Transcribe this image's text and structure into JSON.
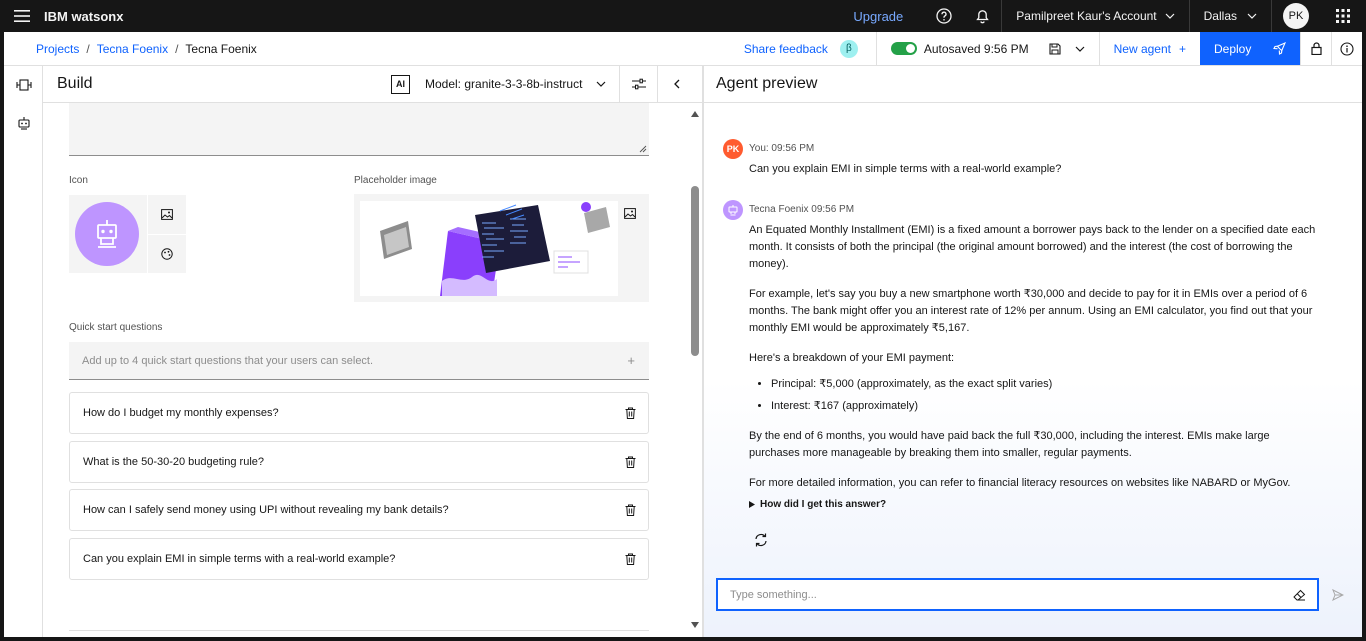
{
  "topbar": {
    "brand": "IBM watsonx",
    "upgrade": "Upgrade",
    "account": "Pamilpreet Kaur's Account",
    "region": "Dallas",
    "avatar_initials": "PK"
  },
  "breadcrumb": {
    "items": [
      "Projects",
      "Tecna Foenix",
      "Tecna Foenix"
    ],
    "separator": "/"
  },
  "actions": {
    "share_feedback": "Share feedback",
    "beta": "β",
    "autosaved": "Autosaved 9:56 PM",
    "new_agent": "New agent",
    "new_agent_icon": "+",
    "deploy": "Deploy"
  },
  "build": {
    "title": "Build",
    "ai_badge": "AI",
    "model": "Model: granite-3-3-8b-instruct",
    "icon_label": "Icon",
    "placeholder_label": "Placeholder image",
    "quick_start_label": "Quick start questions",
    "quick_start_placeholder": "Add up to 4 quick start questions that your users can select.",
    "add_symbol": "+",
    "questions": [
      "How do I budget my monthly expenses?",
      "What is the 50-30-20 budgeting rule?",
      "How can I safely send money using UPI without revealing my bank details?",
      "Can you explain EMI in simple terms with a real-world example?"
    ]
  },
  "preview": {
    "title": "Agent preview",
    "user_initials": "PK",
    "user_meta": "You: 09:56 PM",
    "user_message": "Can you explain EMI in simple terms with a real-world example?",
    "agent_meta": "Tecna Foenix 09:56 PM",
    "agent_p1": "An Equated Monthly Installment (EMI) is a fixed amount a borrower pays back to the lender on a specified date each month. It consists of both the principal (the original amount borrowed) and the interest (the cost of borrowing the money).",
    "agent_p2": "For example, let's say you buy a new smartphone worth ₹30,000 and decide to pay for it in EMIs over a period of 6 months. The bank might offer you an interest rate of 12% per annum. Using an EMI calculator, you find out that your monthly EMI would be approximately ₹5,167.",
    "agent_p3": "Here's a breakdown of your EMI payment:",
    "agent_bullets": [
      "Principal: ₹5,000 (approximately, as the exact split varies)",
      "Interest: ₹167 (approximately)"
    ],
    "agent_p4": "By the end of 6 months, you would have paid back the full ₹30,000, including the interest. EMIs make large purchases more manageable by breaking them into smaller, regular payments.",
    "agent_p5": "For more detailed information, you can refer to financial literacy resources on websites like NABARD or MyGov.",
    "how_did": "How did I get this answer?",
    "input_placeholder": "Type something..."
  },
  "colors": {
    "primary": "#0f62fe",
    "user_avatar": "#ff5b2f",
    "agent_avatar": "#be95ff",
    "toggle_on": "#24a148"
  }
}
